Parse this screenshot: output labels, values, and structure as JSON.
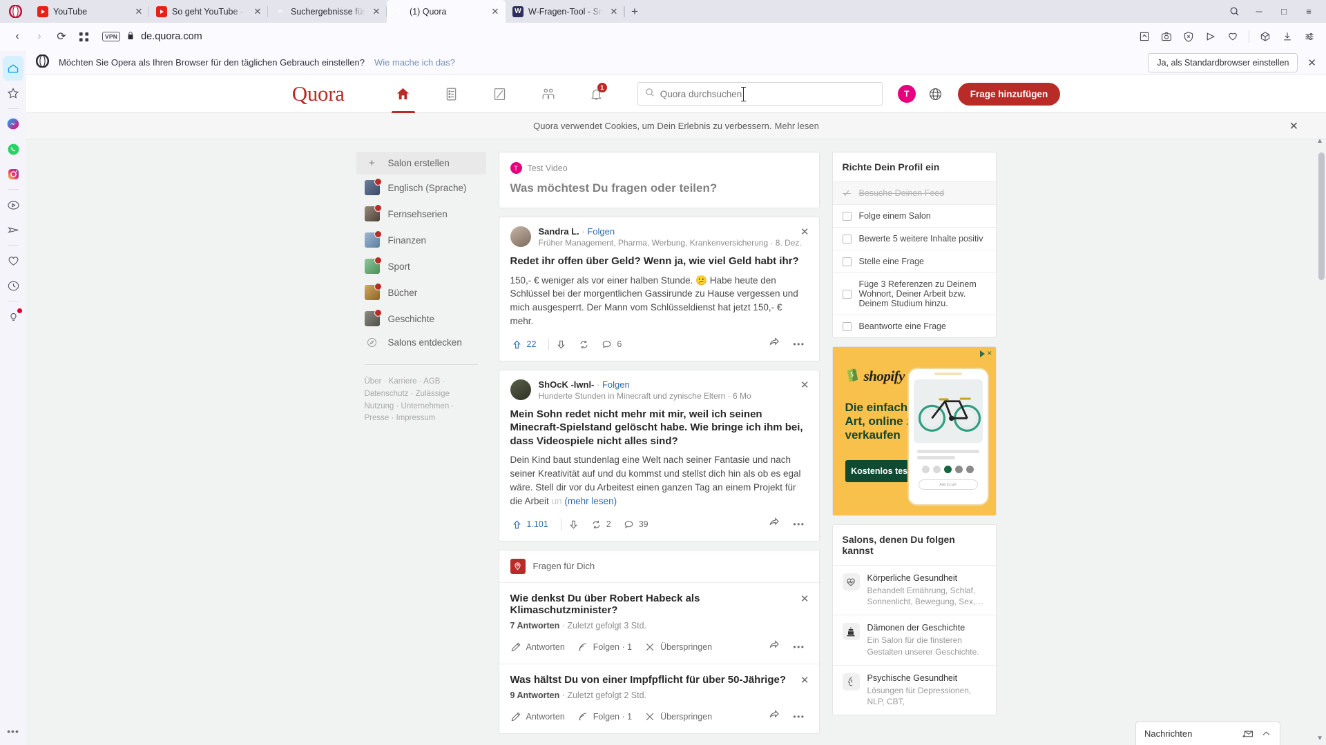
{
  "browser": {
    "tabs": [
      {
        "title": "YouTube",
        "favicon": "youtube-icon",
        "active": false
      },
      {
        "title": "So geht YouTube - YouTube",
        "favicon": "youtube-icon",
        "active": false
      },
      {
        "title": "Suchergebnisse für \"Youtube",
        "favicon": "quora-search-icon",
        "active": false
      },
      {
        "title": "(1) Quora",
        "favicon": "quora-icon",
        "active": true
      },
      {
        "title": "W-Fragen-Tool - Smarte Ic",
        "favicon": "w-icon",
        "active": false
      }
    ],
    "tab_close_label": "✕",
    "new_tab_label": "+",
    "window_controls": {
      "search": "⌕",
      "minimize": "─",
      "maximize": "□",
      "menu": "≡"
    },
    "address": {
      "back": "‹",
      "forward": "›",
      "reload": "⟳",
      "tiles": "▦",
      "vpn_badge": "VPN",
      "lock": "lock-icon",
      "url": "de.quora.com"
    },
    "toolbar_icons": [
      "pin-extension-icon",
      "snapshot-icon",
      "adblock-icon",
      "send-icon",
      "heart-icon",
      "cube-icon",
      "download-icon",
      "easy-setup-icon"
    ],
    "sidebar_icons": [
      "home-icon",
      "star-icon",
      "messenger-icon",
      "whatsapp-icon",
      "instagram-icon",
      "player-icon",
      "telegram-icon",
      "heart-icon",
      "history-icon",
      "tips-icon",
      "more-dots-icon"
    ]
  },
  "notification": {
    "text": "Möchten Sie Opera als Ihren Browser für den täglichen Gebrauch einstellen?",
    "link": "Wie mache ich das?",
    "button": "Ja, als Standardbrowser einstellen",
    "close": "✕"
  },
  "quora": {
    "logo": "Quora",
    "nav": [
      {
        "name": "home-icon",
        "active": true,
        "badge": ""
      },
      {
        "name": "answers-icon",
        "active": false,
        "badge": ""
      },
      {
        "name": "write-icon",
        "active": false,
        "badge": ""
      },
      {
        "name": "spaces-icon",
        "active": false,
        "badge": ""
      },
      {
        "name": "notifications-icon",
        "active": false,
        "badge": "1"
      }
    ],
    "search": {
      "placeholder": "Quora durchsuchen",
      "value": "",
      "icon": "search-icon"
    },
    "avatar_letter": "T",
    "language_icon": "globe-icon",
    "add_question_button": "Frage hinzufügen",
    "cookie_banner": {
      "text": "Quora verwendet Cookies, um Dein Erlebnis zu verbessern.",
      "link": "Mehr lesen",
      "close": "✕"
    },
    "left_sidebar": {
      "create": {
        "label": "Salon erstellen",
        "icon": "plus-icon"
      },
      "items": [
        {
          "label": "Englisch (Sprache)",
          "color1": "#6d7fa0",
          "color2": "#3c4a63"
        },
        {
          "label": "Fernsehserien",
          "color1": "#9a8a7c",
          "color2": "#4a4038"
        },
        {
          "label": "Finanzen",
          "color1": "#9fb6d4",
          "color2": "#5c7fa0"
        },
        {
          "label": "Sport",
          "color1": "#8fc79a",
          "color2": "#4b8f5c"
        },
        {
          "label": "Bücher",
          "color1": "#d4a95e",
          "color2": "#8a6327"
        },
        {
          "label": "Geschichte",
          "color1": "#8d8d85",
          "color2": "#4f4f48"
        }
      ],
      "discover": {
        "label": "Salons entdecken",
        "icon": "compass-icon"
      },
      "footer_links": "Über · Karriere · AGB · Datenschutz · Zulässige Nutzung · Unternehmen · Presse · Impressum"
    },
    "ask_card": {
      "user": "Test Video",
      "avatar_letter": "T",
      "prompt": "Was möchtest Du fragen oder teilen?"
    },
    "posts": [
      {
        "author": "Sandra L.",
        "separator": "·",
        "follow": "Folgen",
        "meta": "Früher Management, Pharma, Werbung, Krankenversicherung · 8. Dez.",
        "title": "Redet ihr offen über Geld? Wenn ja, wie viel Geld habt ihr?",
        "body_pre": "150,- € weniger als vor einer halben Stunde. 😕 Habe heute den Schlüssel bei der morgentlichen Gassirunde zu Hause vergessen und mich ausgesperrt. Der Mann vom Schlüsseldienst hat jetzt 150,- € mehr.",
        "body_fade": "",
        "more_label": "",
        "upvotes": "22",
        "reshares": "",
        "comments": "6",
        "close": "✕",
        "share_icon": "share-icon",
        "more_icon": "more-dots-icon"
      },
      {
        "author": "ShOcK -lwnl-",
        "separator": "·",
        "follow": "Folgen",
        "meta": "Hunderte Stunden in Minecraft und zynische Eltern · 6 Mo",
        "title": "Mein Sohn redet nicht mehr mit mir, weil ich seinen Minecraft-Spielstand gelöscht habe. Wie bringe ich ihm bei, dass Videospiele nicht alles sind?",
        "body_pre": "Dein Kind baut stundenlag eine Welt nach seiner Fantasie und nach seiner Kreativität auf und du kommst und stellst dich hin als ob es egal wäre. Stell dir vor du Arbeitest einen ganzen Tag an einem Projekt für die Arbeit",
        "body_fade": "un",
        "more_label": "(mehr lesen)",
        "upvotes": "1.101",
        "reshares": "2",
        "comments": "39",
        "close": "✕",
        "share_icon": "share-icon",
        "more_icon": "more-dots-icon"
      }
    ],
    "questions_section": {
      "title": "Fragen für Dich",
      "icon": "location-pin-icon",
      "items": [
        {
          "title": "Wie denkst Du über Robert Habeck als Klimaschutzminister?",
          "answers": "7 Antworten",
          "meta_rest": "· Zuletzt gefolgt 3 Std.",
          "answer_label": "Antworten",
          "follow_label": "Folgen · 1",
          "skip_label": "Überspringen",
          "close": "✕"
        },
        {
          "title": "Was hältst Du von einer Impfpflicht für über 50-Jährige?",
          "answers": "9 Antworten",
          "meta_rest": "· Zuletzt gefolgt 2 Std.",
          "answer_label": "Antworten",
          "follow_label": "Folgen · 1",
          "skip_label": "Überspringen",
          "close": "✕"
        }
      ]
    },
    "profile_setup": {
      "title": "Richte Dein Profil ein",
      "items": [
        {
          "label": "Besuche Deinen Feed",
          "done": true
        },
        {
          "label": "Folge einem Salon",
          "done": false
        },
        {
          "label": "Bewerte 5 weitere Inhalte positiv",
          "done": false
        },
        {
          "label": "Stelle eine Frage",
          "done": false
        },
        {
          "label": "Füge 3 Referenzen zu Deinem Wohnort, Deiner Arbeit bzw. Deinem Studium hinzu.",
          "done": false
        },
        {
          "label": "Beantworte eine Frage",
          "done": false
        }
      ]
    },
    "ad": {
      "brand": "shopify",
      "headline": "Die einfachste Art, online zu verkaufen",
      "button": "Kostenlos testen",
      "ad_choices": "AdChoices",
      "close": "✕"
    },
    "salons_panel": {
      "title": "Salons, denen Du folgen kannst",
      "items": [
        {
          "name": "Körperliche Gesundheit",
          "desc": "Behandelt Ernährung, Schlaf, Sonnenlicht, Bewegung, Sex,…",
          "icon": "heart-pulse-icon"
        },
        {
          "name": "Dämonen der Geschichte",
          "desc": "Ein Salon für die finsteren Gestalten unserer Geschichte.",
          "icon": "dark-tower-icon"
        },
        {
          "name": "Psychische Gesundheit",
          "desc": "Lösungen für Depressionen, NLP, CBT,",
          "icon": "mind-icon"
        }
      ]
    },
    "messages_bar": {
      "title": "Nachrichten",
      "compose_icon": "compose-message-icon",
      "expand_icon": "chevron-up-icon"
    }
  }
}
